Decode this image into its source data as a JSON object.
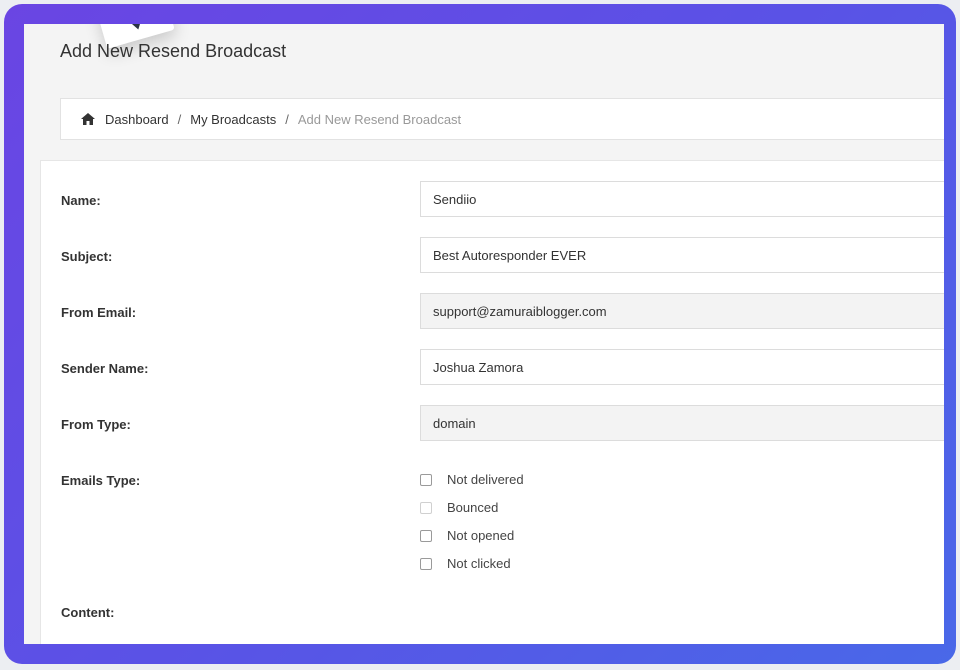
{
  "page": {
    "title": "Add New Resend Broadcast"
  },
  "breadcrumb": {
    "items": [
      "Dashboard",
      "My Broadcasts"
    ],
    "current": "Add New Resend Broadcast"
  },
  "form": {
    "name": {
      "label": "Name:",
      "value": "Sendiio"
    },
    "subject": {
      "label": "Subject:",
      "value": "Best Autoresponder EVER"
    },
    "from_email": {
      "label": "From Email:",
      "value": "support@zamuraiblogger.com"
    },
    "sender_name": {
      "label": "Sender Name:",
      "value": "Joshua Zamora"
    },
    "from_type": {
      "label": "From Type:",
      "value": "domain"
    },
    "emails_type": {
      "label": "Emails Type:",
      "options": [
        "Not delivered",
        "Bounced",
        "Not opened",
        "Not clicked"
      ]
    },
    "content": {
      "label": "Content:"
    }
  },
  "colors": {
    "frame_gradient_start": "#6a45e3",
    "frame_gradient_end": "#4968e8"
  }
}
